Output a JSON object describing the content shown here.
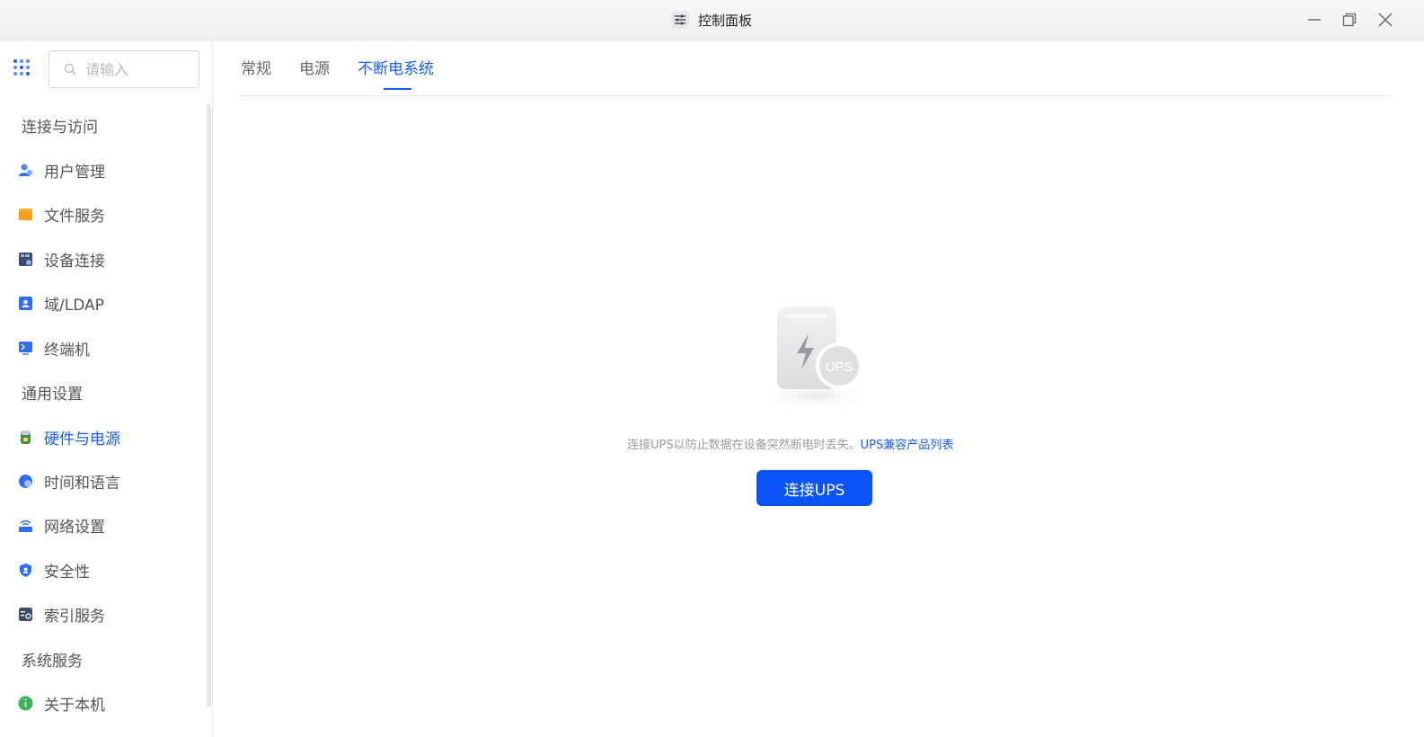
{
  "window": {
    "title": "控制面板",
    "title_icon": "sliders-icon",
    "controls": [
      "minimize-icon",
      "restore-icon",
      "close-icon"
    ]
  },
  "sidebar": {
    "search": {
      "placeholder": "请输入",
      "value": ""
    },
    "groups": [
      {
        "label": "连接与访问"
      },
      {
        "label": "通用设置"
      },
      {
        "label": "系统服务"
      }
    ],
    "items": [
      {
        "label": "用户管理",
        "icon": "user-management-icon",
        "active": false
      },
      {
        "label": "文件服务",
        "icon": "folder-icon",
        "active": false
      },
      {
        "label": "设备连接",
        "icon": "device-icon",
        "active": false
      },
      {
        "label": "域/LDAP",
        "icon": "domain-icon",
        "active": false
      },
      {
        "label": "终端机",
        "icon": "terminal-icon",
        "active": false
      },
      {
        "label": "硬件与电源",
        "icon": "hardware-power-icon",
        "active": true
      },
      {
        "label": "时间和语言",
        "icon": "globe-icon",
        "active": false
      },
      {
        "label": "网络设置",
        "icon": "router-icon",
        "active": false
      },
      {
        "label": "安全性",
        "icon": "shield-icon",
        "active": false
      },
      {
        "label": "索引服务",
        "icon": "index-icon",
        "active": false
      },
      {
        "label": "关于本机",
        "icon": "info-icon",
        "active": false
      }
    ]
  },
  "tabs": [
    {
      "label": "常规",
      "active": false
    },
    {
      "label": "电源",
      "active": false
    },
    {
      "label": "不断电系统",
      "active": true
    }
  ],
  "ups": {
    "illustration_text": "UPS",
    "message": "连接UPS以防止数据在设备突然断电时丢失。",
    "link": "UPS兼容产品列表",
    "button": "连接UPS"
  },
  "colors": {
    "accent": "#1a5df5",
    "button": "#0a53f7"
  }
}
